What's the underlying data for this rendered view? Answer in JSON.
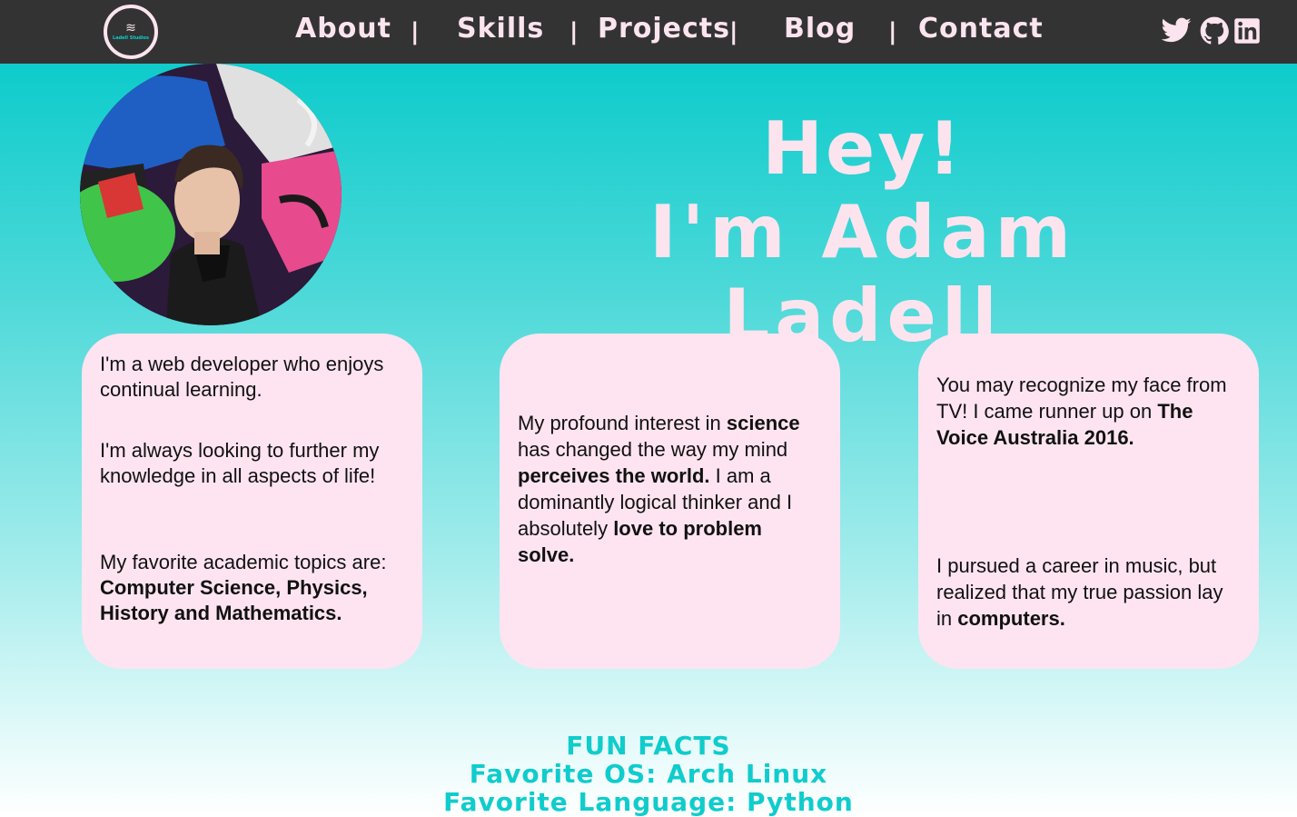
{
  "nav": {
    "logo_text": "Ladell Studios",
    "links": [
      "About",
      "Skills",
      "Projects",
      "Blog",
      "Contact"
    ],
    "separator": "|",
    "social": [
      "twitter-icon",
      "github-icon",
      "linkedin-icon"
    ]
  },
  "hero": {
    "line1": "Hey!",
    "line2": "I'm Adam Ladell"
  },
  "cards": [
    {
      "paragraphs": [
        {
          "text": "I'm a web developer who enjoys continual learning.",
          "bold": ""
        },
        {
          "text": "I'm always looking to further my knowledge in all aspects of life!",
          "bold": ""
        },
        {
          "text": "My favorite academic topics are: ",
          "bold": "Computer Science, Physics, History and Mathematics."
        }
      ]
    },
    {
      "parts": [
        "My profound interest in ",
        "science",
        " has changed the way my mind ",
        "perceives the world.",
        " I am a dominantly logical thinker and I absolutely ",
        "love to problem solve."
      ]
    },
    {
      "p1": [
        "You may recognize my face from TV! I came runner up on ",
        "The Voice Australia 2016."
      ],
      "p2": [
        "I pursued a career in music, but realized that my true passion lay in ",
        "computers."
      ]
    }
  ],
  "fun_facts": {
    "heading": "FUN FACTS",
    "os": "Favorite OS: Arch Linux",
    "language": "Favorite Language: Python"
  },
  "colors": {
    "navbar": "#333333",
    "accent_pink": "#fce4ef",
    "accent_teal": "#10cccc"
  }
}
